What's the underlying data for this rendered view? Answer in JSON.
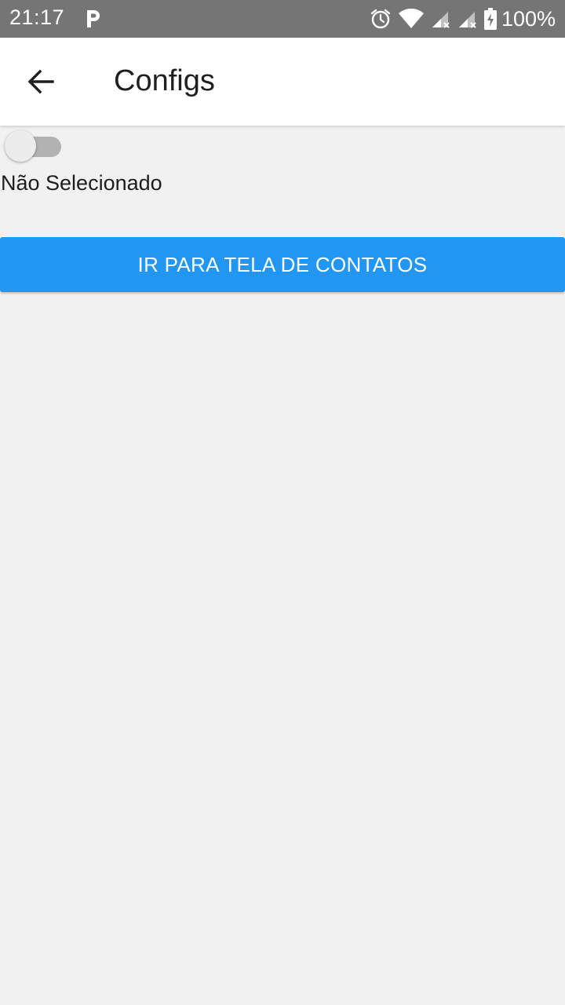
{
  "status_bar": {
    "time": "21:17",
    "battery": "100%",
    "icons": [
      "parking-icon",
      "alarm-icon",
      "wifi-icon",
      "signal-icon",
      "signal-icon",
      "battery-charging-icon"
    ]
  },
  "app_bar": {
    "back_icon": "arrow-left-icon",
    "title": "Configs"
  },
  "settings": {
    "toggle": {
      "state": "off",
      "label": "Não Selecionado"
    }
  },
  "actions": {
    "contacts_button_label": "IR PARA TELA DE CONTATOS"
  },
  "colors": {
    "status_bar": "#757575",
    "background": "#f1f1f1",
    "primary_button": "#2196f3"
  }
}
